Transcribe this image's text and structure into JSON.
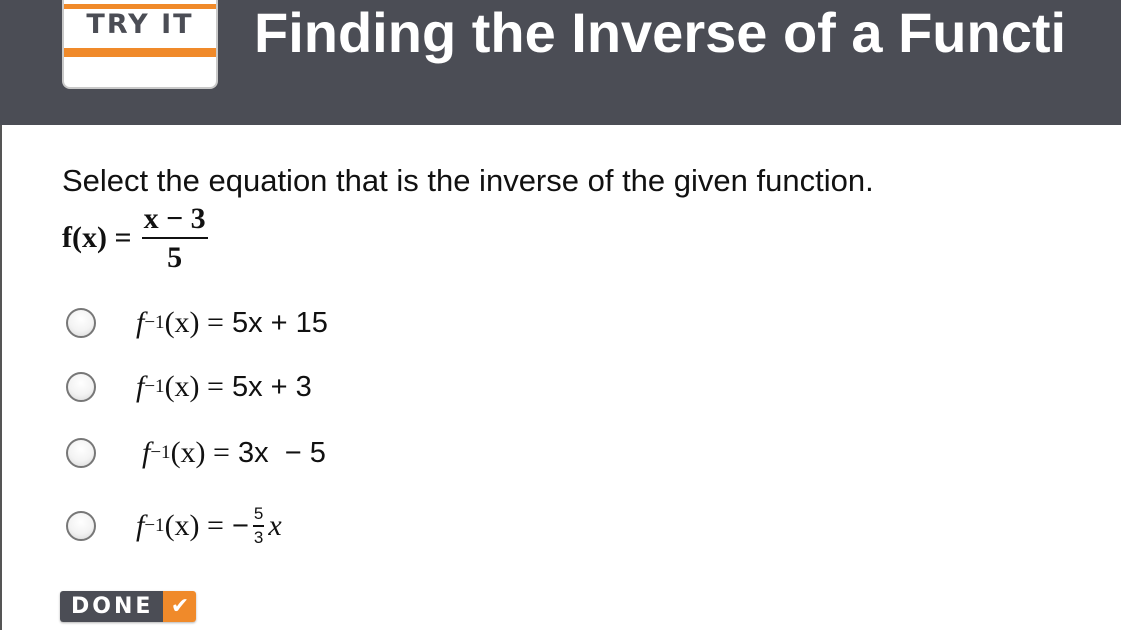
{
  "header": {
    "badge_label": "TRY IT",
    "title": "Finding the Inverse of a Functi"
  },
  "question": {
    "prompt": "Select the equation that is the inverse of the given function.",
    "function_lhs": "f(x) =",
    "function_numerator": "x − 3",
    "function_denominator": "5"
  },
  "options": [
    {
      "f": "f",
      "exp": "−1",
      "arg": "(x) =",
      "rhs": "5x + 15"
    },
    {
      "f": "f",
      "exp": "−1",
      "arg": "(x) =",
      "rhs": "5x + 3"
    },
    {
      "f": "f",
      "exp": "−1",
      "arg": "(x) =",
      "rhs": "3x  − 5"
    },
    {
      "f": "f",
      "exp": "−1",
      "arg": "(x) =",
      "rhs_prefix": "−",
      "rhs_num": "5",
      "rhs_den": "3",
      "rhs_suffix": "x"
    }
  ],
  "done_button": {
    "label": "DONE",
    "icon": "checkmark-icon",
    "check_glyph": "✔"
  },
  "colors": {
    "header_bg": "#4b4d55",
    "accent_orange": "#f08a2a",
    "title_text": "#ffffff"
  }
}
